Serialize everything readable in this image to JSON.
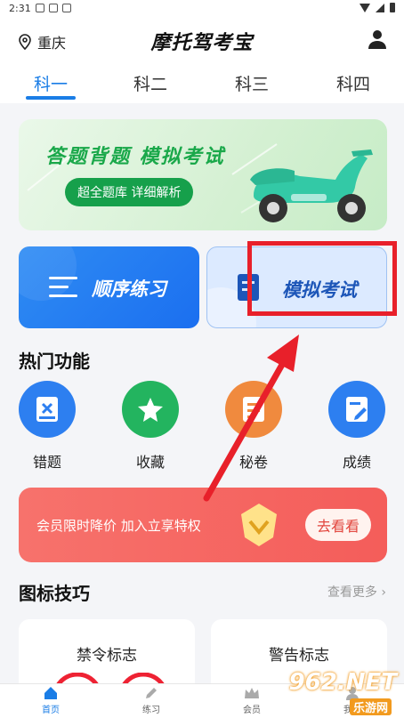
{
  "status_bar": {
    "time": "2:31"
  },
  "header": {
    "location": "重庆",
    "title": "摩托驾考宝"
  },
  "tabs": [
    {
      "label": "科一",
      "active": true
    },
    {
      "label": "科二",
      "active": false
    },
    {
      "label": "科三",
      "active": false
    },
    {
      "label": "科四",
      "active": false
    }
  ],
  "banner": {
    "headline": "答题背题 模拟考试",
    "pill": "超全题库 详细解析"
  },
  "practice": {
    "sequential": "顺序练习",
    "mock_exam": "模拟考试"
  },
  "hot_features": {
    "title": "热门功能",
    "items": [
      {
        "label": "错题",
        "icon": "wrong-questions-icon",
        "color": "#2d7ff0"
      },
      {
        "label": "收藏",
        "icon": "star-icon",
        "color": "#23b45f"
      },
      {
        "label": "秘卷",
        "icon": "secret-paper-icon",
        "color": "#f08a3e"
      },
      {
        "label": "成绩",
        "icon": "score-icon",
        "color": "#2d7ff0"
      }
    ]
  },
  "member": {
    "text": "会员限时降价 加入立享特权",
    "button": "去看看"
  },
  "icon_tips": {
    "title": "图标技巧",
    "more": "查看更多 ›",
    "cards": [
      "禁令标志",
      "警告标志"
    ]
  },
  "bottom_nav": [
    {
      "label": "首页",
      "icon": "home-icon",
      "active": true
    },
    {
      "label": "练习",
      "icon": "pencil-icon",
      "active": false
    },
    {
      "label": "会员",
      "icon": "crown-icon",
      "active": false
    },
    {
      "label": "我的",
      "icon": "person-icon",
      "active": false
    }
  ],
  "watermark": {
    "brand": "962.NET",
    "sub": "乐游网"
  },
  "colors": {
    "accent": "#1a7de6",
    "annotation": "#e8202a"
  }
}
